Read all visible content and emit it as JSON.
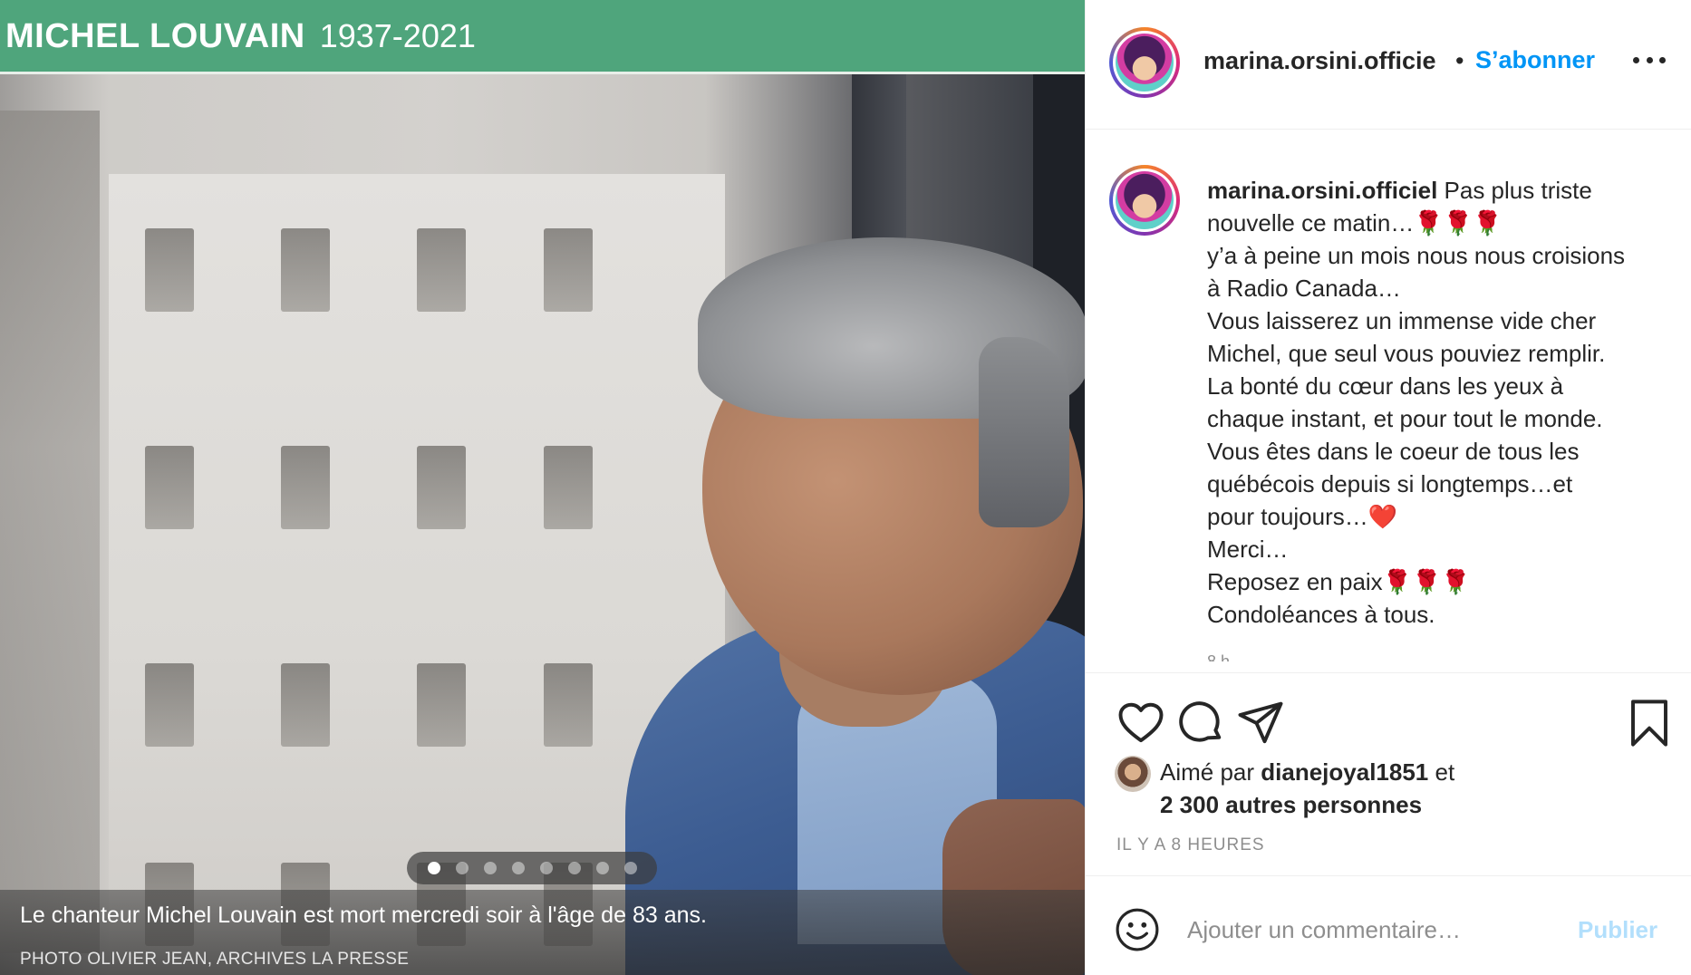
{
  "media": {
    "banner_name": "MICHEL LOUVAIN",
    "banner_years": "1937-2021",
    "caption": "Le chanteur Michel Louvain est mort mercredi soir à l'âge de 83 ans.",
    "credit": "PHOTO OLIVIER JEAN, ARCHIVES LA PRESSE",
    "carousel": {
      "total": 8,
      "active": 1
    },
    "banner_color": "#4fa57c"
  },
  "header": {
    "username": "marina.orsini.officie",
    "separator": "•",
    "follow_label": "S’abonner"
  },
  "post": {
    "username": "marina.orsini.officiel",
    "lines": [
      "Pas plus triste",
      "nouvelle ce matin…🌹🌹🌹",
      "y’a à peine un mois nous nous croisions",
      "à Radio Canada…",
      "Vous laisserez un immense vide cher",
      "Michel, que seul vous pouviez remplir.",
      "La bonté du cœur dans les yeux à",
      "chaque instant, et pour tout le monde.",
      "Vous êtes dans le coeur de tous les",
      "québécois depuis si longtemps…et",
      "pour toujours…❤️",
      "Merci…",
      "Reposez en paix🌹🌹🌹",
      "Condoléances à tous."
    ],
    "time_peek": "8 h"
  },
  "likes": {
    "prefix": "Aimé par ",
    "user": "dianejoyal1851",
    "suffix": " et",
    "others": "2 300 autres personnes"
  },
  "timestamp": "IL Y A 8 HEURES",
  "comment": {
    "placeholder": "Ajouter un commentaire…",
    "publish_label": "Publier"
  },
  "icons": [
    "heart-icon",
    "comment-icon",
    "share-icon",
    "bookmark-icon",
    "more-icon",
    "emoji-icon"
  ],
  "colors": {
    "follow": "#0095f6",
    "publish_disabled": "#b2dffc",
    "muted": "#8e8e8e"
  }
}
